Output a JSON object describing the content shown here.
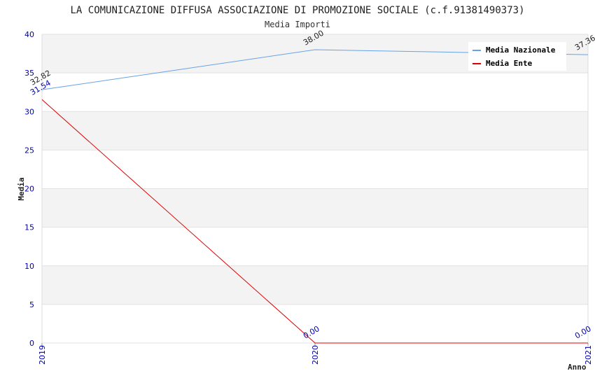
{
  "chart_data": {
    "type": "line",
    "title": "LA COMUNICAZIONE DIFFUSA ASSOCIAZIONE DI PROMOZIONE SOCIALE (c.f.91381490373)",
    "subtitle": "Media Importi",
    "xlabel": "Anno",
    "ylabel": "Media",
    "categories": [
      "2019",
      "2020",
      "2021"
    ],
    "ylim": [
      0,
      40
    ],
    "yticks": [
      0,
      5,
      10,
      15,
      20,
      25,
      30,
      35,
      40
    ],
    "grid": true,
    "legend_position": "top-right",
    "series": [
      {
        "name": "Media Nazionale",
        "color": "#66a3e6",
        "label_color": "#222222",
        "values": [
          32.82,
          38.0,
          37.36
        ],
        "labels": [
          "32.82",
          "38.00",
          "37.36"
        ]
      },
      {
        "name": "Media Ente",
        "color": "#dd0000",
        "label_color": "#0000aa",
        "values": [
          31.54,
          0.0,
          0.0
        ],
        "labels": [
          "31.54",
          "0.00",
          "0.00"
        ]
      }
    ]
  }
}
